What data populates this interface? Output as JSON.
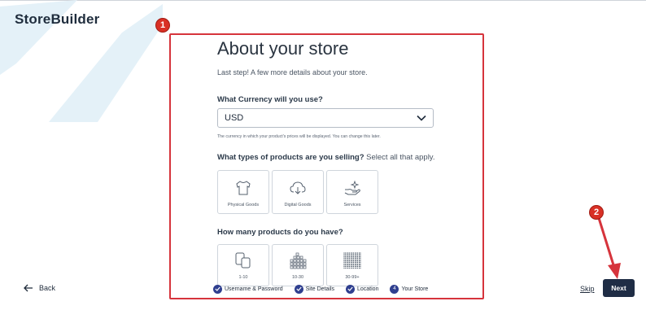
{
  "brand": "StoreBuilder",
  "annotations": [
    "1",
    "2"
  ],
  "page": {
    "title": "About your store",
    "subtitle": "Last step! A few more details about your store."
  },
  "currency": {
    "question": "What Currency will you use?",
    "value": "USD",
    "helper": "The currency in which your product's prices will be displayed. You can change this later."
  },
  "product_types": {
    "question": "What types of products are you selling?",
    "question_suffix": " Select all that apply.",
    "options": [
      {
        "label": "Physical Goods",
        "icon": "tshirt-icon"
      },
      {
        "label": "Digital Goods",
        "icon": "cloud-download-icon"
      },
      {
        "label": "Services",
        "icon": "hand-sparkle-icon"
      }
    ]
  },
  "product_count": {
    "question": "How many products do you have?",
    "options": [
      {
        "label": "1-10",
        "icon": "few-products-icon"
      },
      {
        "label": "10-30",
        "icon": "some-products-icon"
      },
      {
        "label": "30-99+",
        "icon": "many-products-icon"
      }
    ]
  },
  "steps": [
    {
      "label": "Username & Password",
      "state": "complete"
    },
    {
      "label": "Site Details",
      "state": "complete"
    },
    {
      "label": "Location",
      "state": "complete"
    },
    {
      "label": "Your Store",
      "state": "current",
      "number": "4"
    }
  ],
  "nav": {
    "back_label": "Back",
    "skip_label": "Skip",
    "next_label": "Next"
  },
  "colors": {
    "annotation_red": "#d6343c",
    "primary_navy": "#1f2d45",
    "step_blue": "#2f3f8f"
  }
}
